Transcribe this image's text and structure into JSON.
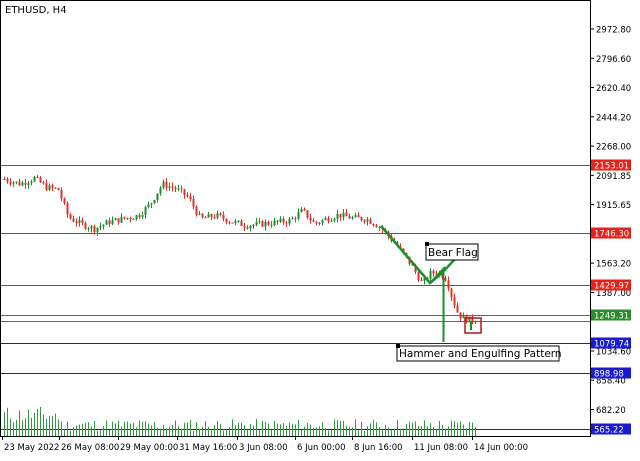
{
  "window": {
    "symbol_title": "ETHUSD, H4"
  },
  "chart_data": {
    "type": "candlestick",
    "title": "ETHUSD, H4",
    "ylim": [
      565.22,
      3148.51
    ],
    "y_ticks": [
      "2972.80",
      "2796.60",
      "2620.40",
      "2444.20",
      "2268.00",
      "2091.85",
      "1915.65",
      "1739.45",
      "1563.20",
      "1387.00",
      "1034.60",
      "858.40",
      "682.20"
    ],
    "x_ticks": [
      "23 May 2022",
      "26 May 08:00",
      "29 May 00:00",
      "31 May 16:00",
      "3 Jun 08:00",
      "6 Jun 00:00",
      "8 Jun 16:00",
      "11 Jun 08:00",
      "14 Jun 00:00"
    ],
    "colors": {
      "bull": "#1a8f2c",
      "bear": "#e0302a",
      "volume": "#2d9c3a"
    },
    "horizontal_lines": [
      {
        "value": 2153.01,
        "label": "2153.01",
        "color": "#e8201a"
      },
      {
        "value": 1746.3,
        "label": "1746.30",
        "color": "#e8201a"
      },
      {
        "value": 1429.97,
        "label": "1429.97",
        "color": "#e8201a"
      },
      {
        "value": 1249.31,
        "label": "1249.31",
        "color": "#2b8c2b"
      },
      {
        "value": 1214.0,
        "label": "",
        "color": "#2b8c2b"
      },
      {
        "value": 1079.74,
        "label": "1079.74",
        "color": "#1a1ad0"
      },
      {
        "value": 898.98,
        "label": "898.98",
        "color": "#1a1ad0"
      },
      {
        "value": 565.22,
        "label": "565.22",
        "color": "#1a1ad0"
      }
    ],
    "annotations": [
      {
        "text": "Bear Flag"
      },
      {
        "text": "Hammer and Engulfing Pattern"
      }
    ]
  }
}
